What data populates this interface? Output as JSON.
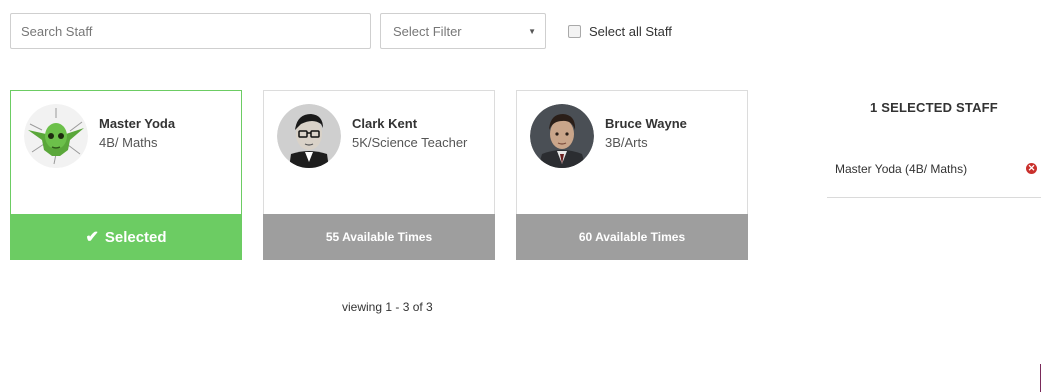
{
  "search": {
    "placeholder": "Search Staff"
  },
  "filter": {
    "label": "Select Filter",
    "caret": "▼"
  },
  "select_all": {
    "label": "Select all Staff",
    "checked": false
  },
  "staff": [
    {
      "name": "Master Yoda",
      "role": "4B/ Maths",
      "footer": "Selected",
      "selected": true,
      "avatar_icon": "yoda-avatar"
    },
    {
      "name": "Clark Kent",
      "role": "5K/Science Teacher",
      "footer": "55 Available Times",
      "selected": false,
      "avatar_icon": "clark-kent-avatar"
    },
    {
      "name": "Bruce Wayne",
      "role": "3B/Arts",
      "footer": "60 Available Times",
      "selected": false,
      "avatar_icon": "bruce-wayne-avatar"
    }
  ],
  "pagination": {
    "text": "viewing 1 - 3 of 3"
  },
  "selected_panel": {
    "title": "1 SELECTED STAFF",
    "items": [
      {
        "label": "Master Yoda (4B/ Maths)"
      }
    ]
  },
  "colors": {
    "selected_green": "#6ccc63",
    "available_gray": "#9e9e9e",
    "remove_red": "#c9302c"
  }
}
